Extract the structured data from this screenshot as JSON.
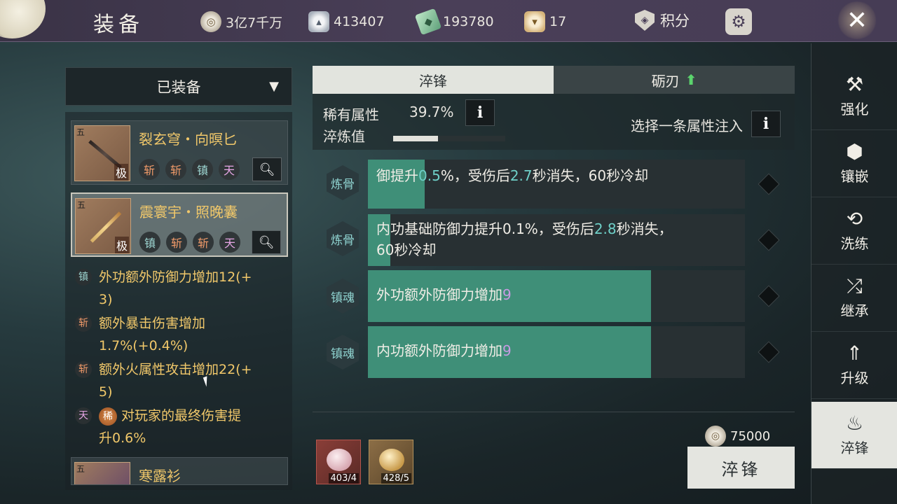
{
  "header": {
    "title": "装备",
    "resources": [
      {
        "icon": "coin-icon",
        "value": "3亿7千万"
      },
      {
        "icon": "silver-ingot-icon",
        "value": "413407"
      },
      {
        "icon": "jade-icon",
        "value": "193780"
      },
      {
        "icon": "ticket-icon",
        "value": "17"
      }
    ],
    "points_label": "积分",
    "close_symbol": "✕"
  },
  "left": {
    "filter_label": "已装备",
    "items": [
      {
        "name": "裂玄穹・向暝匕",
        "grade": "五",
        "tier": "极",
        "tags": [
          "斩",
          "斩",
          "镇",
          "天"
        ]
      },
      {
        "name": "震寰宇・照晚囊",
        "grade": "五",
        "tier": "极",
        "tags": [
          "镇",
          "斩",
          "斩",
          "天"
        ]
      },
      {
        "name": "寒露衫",
        "grade": "五",
        "tier": "",
        "tags": []
      }
    ],
    "attributes": [
      {
        "badge": "镇",
        "text": "外功额外防御力增加12(+",
        "text2": "3)"
      },
      {
        "badge": "斩",
        "text": "额外暴击伤害增加",
        "text2": "1.7%(+0.4%)"
      },
      {
        "badge": "斩",
        "text": "额外火属性攻击增加22(+",
        "text2": "5)"
      },
      {
        "badge": "天",
        "rare": "稀",
        "text": "对玩家的最终伤害提",
        "text2": "升0.6%"
      }
    ]
  },
  "tabs": {
    "active": "淬锋",
    "inactive": "砺刃",
    "inactive_arrow": "⬆"
  },
  "refine": {
    "rare_label": "稀有属性",
    "rare_value": "39.7%",
    "refine_label": "淬炼值",
    "refine_progress": 0.4,
    "choose_label": "选择一条属性注入",
    "info_symbol": "i"
  },
  "options": [
    {
      "badge": "炼骨",
      "text_a": "御提升",
      "num": "0.5",
      "text_b": "%，受伤后",
      "num2": "2.7",
      "text_c": "秒消失，60秒冷却",
      "fill": 0.15
    },
    {
      "badge": "炼骨",
      "text_a": "内功基础防御力提升0.1%，受伤后",
      "num": "2.8",
      "text_b": "秒消失，",
      "text_c": "60秒冷却",
      "fill": 0.06
    },
    {
      "badge": "镇魂",
      "text_a": "外功额外防御力增加",
      "num": "9",
      "fill": 0.75
    },
    {
      "badge": "镇魂",
      "text_a": "内功额外防御力增加",
      "num": "9",
      "fill": 0.75
    }
  ],
  "materials": [
    {
      "count": "403/4"
    },
    {
      "count": "428/5"
    }
  ],
  "cost": "75000",
  "refine_button": "淬锋",
  "nav": [
    {
      "label": "强化",
      "icon": "hammer-icon"
    },
    {
      "label": "镶嵌",
      "icon": "gem-icon"
    },
    {
      "label": "洗练",
      "icon": "refresh-icon"
    },
    {
      "label": "继承",
      "icon": "inherit-icon"
    },
    {
      "label": "升级",
      "icon": "upgrade-icon"
    },
    {
      "label": "淬锋",
      "icon": "flame-icon"
    }
  ]
}
